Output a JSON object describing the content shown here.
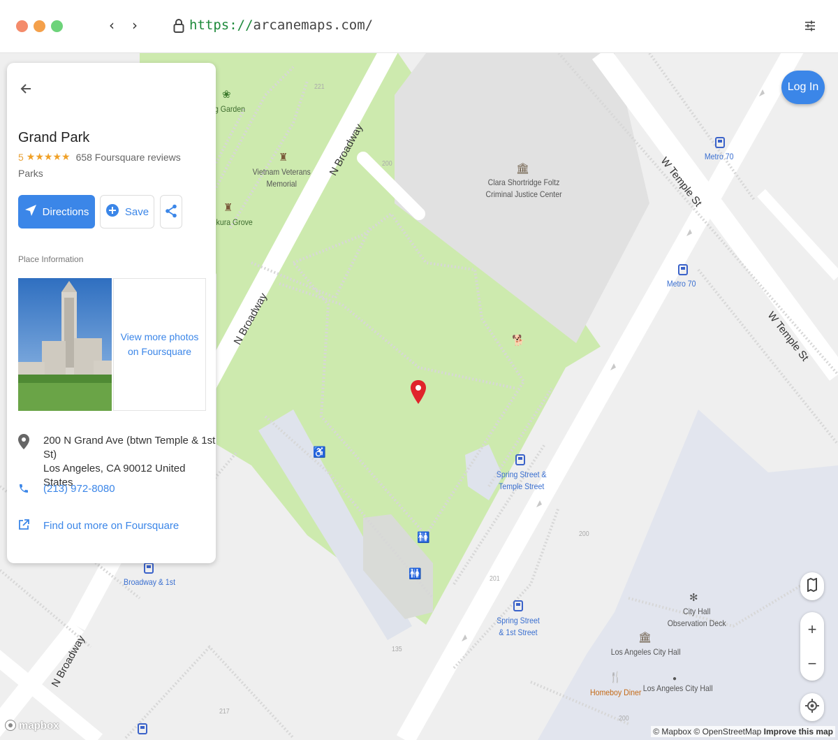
{
  "browser": {
    "url_scheme": "https://",
    "url_host": "arcanemaps.com/",
    "back_glyph": "‹",
    "forward_glyph": "›"
  },
  "place": {
    "name": "Grand Park",
    "rating": "5",
    "stars": "★★★★★",
    "reviews": "658 Foursquare reviews",
    "category": "Parks",
    "directions_label": "Directions",
    "save_label": "Save",
    "section_title": "Place Information",
    "photos_more": "View more photos on Foursquare",
    "address_line1": "200 N Grand Ave (btwn Temple & 1st St)",
    "address_line2": "Los Angeles, CA 90012 United States",
    "phone": "(213) 972-8080",
    "more_link": "Find out more on Foursquare"
  },
  "map": {
    "login_label": "Log In",
    "zoom_in": "+",
    "zoom_out": "−",
    "logo_text": "mapbox",
    "attribution": "© Mapbox © OpenStreetMap",
    "improve": "Improve this map",
    "labels": {
      "garden": "g Garden",
      "vietnam1": "Vietnam Veterans",
      "vietnam2": "Memorial",
      "sakura": "kura Grove",
      "clara1": "Clara Shortridge Foltz",
      "clara2": "Criminal Justice Center",
      "metro70a": "Metro 70",
      "metro70b": "Metro 70",
      "spring_temple1": "Spring Street &",
      "spring_temple2": "Temple Street",
      "spring_1st1": "Spring Street",
      "spring_1st2": "& 1st Street",
      "broadway_1st": "Broadway & 1st",
      "cityhall_obs1": "City Hall",
      "cityhall_obs2": "Observation Deck",
      "la_cityhall_a": "Los Angeles City Hall",
      "la_cityhall_b": "Los Angeles City Hall",
      "homeboy": "Homeboy Diner"
    },
    "streets": {
      "broadway_top": "N Broadway",
      "broadway_mid": "N Broadway",
      "broadway_bot": "N Broadway",
      "temple_top": "W Temple St",
      "temple_right": "W Temple St"
    },
    "numbers": {
      "n221": "221",
      "n200a": "200",
      "n200b": "200",
      "n201": "201",
      "n135": "135",
      "n217": "217",
      "n200c": "200"
    },
    "colors": {
      "park": "#cdeaae",
      "road": "#ffffff",
      "building": "#e0e0e0",
      "accent": "#3b86e8",
      "pin": "#e0242b"
    }
  }
}
